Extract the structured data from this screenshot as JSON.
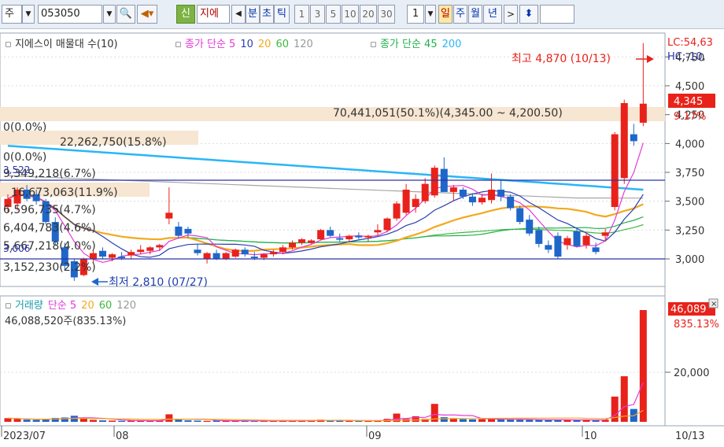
{
  "toolbar": {
    "market": "주",
    "code": "053050",
    "name": "지에",
    "badge": "신",
    "branch_label": "분",
    "chart_label": "초",
    "tick_label": "틱",
    "periods": [
      "1",
      "3",
      "5",
      "10",
      "20",
      "30"
    ],
    "interval_value": "1",
    "day": "일",
    "week": "주",
    "month": "월",
    "year": "년"
  },
  "price_panel": {
    "legend": {
      "title": "지에스이 매물대 수(10)",
      "ma_label_a": "종가 단순 5",
      "ma_a_rest": [
        "10",
        "20",
        "60",
        "120"
      ],
      "ma_label_b": "종가 단순 45",
      "ma_b_rest": "200"
    },
    "volume_profile": [
      "70,441,051(50.1%)(4,345.00 ~ 4,200.50)",
      "0(0.0%)",
      "22,262,750(15.8%)",
      "0(0.0%)",
      "9,349,218(6.7%)",
      "16,673,063(11.9%)",
      "6,596,735(4.7%)",
      "6,404,783(4.6%)",
      "5,667,218(4.0%)",
      "3,152,230(2.2%)"
    ],
    "left_labels": [
      "3,522",
      "3,006"
    ],
    "annotation_high": "최고 4,870 (10/13)",
    "annotation_low": "최저 2,810 (07/27)",
    "right_labels": {
      "lc": "LC:54,63",
      "hc": "HC:-10,",
      "last_price": "4,345",
      "change_pct": "9.17%"
    },
    "yaxis_ticks": [
      "4,750",
      "4,500",
      "4,250",
      "4,000",
      "3,750",
      "3,500",
      "3,250",
      "3,000"
    ]
  },
  "volume_panel": {
    "legend_title": "거래량",
    "legend_ma": "단순 5",
    "legend_ma_rest": [
      "20",
      "60",
      "120"
    ],
    "value_text": "46,088,520주(835.13%)",
    "right_value": "46,089",
    "right_pct": "835.13%",
    "yaxis_tick": "20,000"
  },
  "xaxis": {
    "labels": [
      "2023/07",
      "08",
      "09",
      "10"
    ],
    "end_label": "10/13"
  },
  "colors": {
    "up": "#e8221b",
    "down": "#1f66c9",
    "ma5": "#e33ad8",
    "ma10": "#2c3fb0",
    "ma20": "#f2a91d",
    "ma60": "#3fb83f",
    "ma120": "#a6a6a6",
    "ma45": "#22b14c",
    "ma200": "#29b6f6"
  },
  "candles": [
    {
      "o": 3450,
      "h": 3560,
      "l": 3400,
      "c": 3520
    },
    {
      "o": 3480,
      "h": 3620,
      "l": 3420,
      "c": 3600
    },
    {
      "o": 3600,
      "h": 3640,
      "l": 3500,
      "c": 3520
    },
    {
      "o": 3560,
      "h": 3600,
      "l": 3470,
      "c": 3500
    },
    {
      "o": 3500,
      "h": 3520,
      "l": 3300,
      "c": 3320
    },
    {
      "o": 3320,
      "h": 3360,
      "l": 3120,
      "c": 3150
    },
    {
      "o": 3100,
      "h": 3140,
      "l": 2900,
      "c": 2940
    },
    {
      "o": 2980,
      "h": 3000,
      "l": 2810,
      "c": 2840
    },
    {
      "o": 2860,
      "h": 3010,
      "l": 2850,
      "c": 3000
    },
    {
      "o": 3000,
      "h": 3080,
      "l": 2960,
      "c": 3050
    },
    {
      "o": 3070,
      "h": 3100,
      "l": 3000,
      "c": 3020
    },
    {
      "o": 3010,
      "h": 3050,
      "l": 2980,
      "c": 3040
    },
    {
      "o": 3020,
      "h": 3060,
      "l": 2990,
      "c": 3010
    },
    {
      "o": 3030,
      "h": 3080,
      "l": 3000,
      "c": 3060
    },
    {
      "o": 3060,
      "h": 3120,
      "l": 3040,
      "c": 3080
    },
    {
      "o": 3070,
      "h": 3110,
      "l": 3040,
      "c": 3100
    },
    {
      "o": 3100,
      "h": 3130,
      "l": 3070,
      "c": 3120
    },
    {
      "o": 3350,
      "h": 3620,
      "l": 3300,
      "c": 3400
    },
    {
      "o": 3280,
      "h": 3320,
      "l": 3180,
      "c": 3200
    },
    {
      "o": 3260,
      "h": 3280,
      "l": 3180,
      "c": 3220
    },
    {
      "o": 3080,
      "h": 3130,
      "l": 3030,
      "c": 3050
    },
    {
      "o": 3000,
      "h": 3060,
      "l": 2960,
      "c": 3050
    },
    {
      "o": 3050,
      "h": 3080,
      "l": 2990,
      "c": 3000
    },
    {
      "o": 3000,
      "h": 3060,
      "l": 2990,
      "c": 3050
    },
    {
      "o": 3020,
      "h": 3090,
      "l": 3010,
      "c": 3080
    },
    {
      "o": 3080,
      "h": 3100,
      "l": 3020,
      "c": 3040
    },
    {
      "o": 3020,
      "h": 3060,
      "l": 2990,
      "c": 3010
    },
    {
      "o": 3010,
      "h": 3050,
      "l": 2990,
      "c": 3040
    },
    {
      "o": 3040,
      "h": 3080,
      "l": 3020,
      "c": 3060
    },
    {
      "o": 3060,
      "h": 3120,
      "l": 3040,
      "c": 3100
    },
    {
      "o": 3100,
      "h": 3160,
      "l": 3080,
      "c": 3140
    },
    {
      "o": 3140,
      "h": 3180,
      "l": 3120,
      "c": 3170
    },
    {
      "o": 3140,
      "h": 3170,
      "l": 3130,
      "c": 3160
    },
    {
      "o": 3170,
      "h": 3260,
      "l": 3160,
      "c": 3250
    },
    {
      "o": 3250,
      "h": 3280,
      "l": 3190,
      "c": 3200
    },
    {
      "o": 3180,
      "h": 3220,
      "l": 3150,
      "c": 3170
    },
    {
      "o": 3170,
      "h": 3210,
      "l": 3150,
      "c": 3200
    },
    {
      "o": 3200,
      "h": 3230,
      "l": 3170,
      "c": 3190
    },
    {
      "o": 3190,
      "h": 3210,
      "l": 3150,
      "c": 3200
    },
    {
      "o": 3230,
      "h": 3300,
      "l": 3200,
      "c": 3250
    },
    {
      "o": 3250,
      "h": 3360,
      "l": 3230,
      "c": 3350
    },
    {
      "o": 3350,
      "h": 3500,
      "l": 3330,
      "c": 3480
    },
    {
      "o": 3400,
      "h": 3650,
      "l": 3380,
      "c": 3600
    },
    {
      "o": 3450,
      "h": 3560,
      "l": 3400,
      "c": 3520
    },
    {
      "o": 3500,
      "h": 3700,
      "l": 3480,
      "c": 3650
    },
    {
      "o": 3550,
      "h": 3810,
      "l": 3530,
      "c": 3790
    },
    {
      "o": 3780,
      "h": 3880,
      "l": 3600,
      "c": 3580
    },
    {
      "o": 3580,
      "h": 3640,
      "l": 3500,
      "c": 3620
    },
    {
      "o": 3600,
      "h": 3620,
      "l": 3520,
      "c": 3540
    },
    {
      "o": 3540,
      "h": 3570,
      "l": 3460,
      "c": 3490
    },
    {
      "o": 3490,
      "h": 3560,
      "l": 3470,
      "c": 3530
    },
    {
      "o": 3510,
      "h": 3740,
      "l": 3480,
      "c": 3600
    },
    {
      "o": 3600,
      "h": 3680,
      "l": 3500,
      "c": 3540
    },
    {
      "o": 3540,
      "h": 3560,
      "l": 3420,
      "c": 3440
    },
    {
      "o": 3440,
      "h": 3460,
      "l": 3300,
      "c": 3320
    },
    {
      "o": 3340,
      "h": 3380,
      "l": 3200,
      "c": 3220
    },
    {
      "o": 3250,
      "h": 3280,
      "l": 3100,
      "c": 3130
    },
    {
      "o": 3120,
      "h": 3160,
      "l": 3050,
      "c": 3080
    },
    {
      "o": 3200,
      "h": 3230,
      "l": 3000,
      "c": 3020
    },
    {
      "o": 3120,
      "h": 3200,
      "l": 3080,
      "c": 3180
    },
    {
      "o": 3240,
      "h": 3260,
      "l": 3100,
      "c": 3110
    },
    {
      "o": 3120,
      "h": 3230,
      "l": 3090,
      "c": 3200
    },
    {
      "o": 3100,
      "h": 3140,
      "l": 3040,
      "c": 3060
    },
    {
      "o": 3200,
      "h": 3260,
      "l": 3150,
      "c": 3230
    },
    {
      "o": 3450,
      "h": 4100,
      "l": 3420,
      "c": 4080
    },
    {
      "o": 3700,
      "h": 4380,
      "l": 3650,
      "c": 4350
    },
    {
      "o": 4080,
      "h": 4170,
      "l": 3980,
      "c": 4020
    },
    {
      "o": 4180,
      "h": 4870,
      "l": 4150,
      "c": 4345
    }
  ],
  "volumes": [
    1.5,
    1.2,
    0.9,
    0.8,
    1.2,
    1.6,
    1.8,
    2.5,
    1.4,
    0.8,
    0.6,
    0.5,
    0.4,
    0.6,
    0.5,
    0.4,
    0.5,
    3.1,
    0.9,
    0.6,
    0.5,
    0.4,
    0.5,
    0.4,
    0.4,
    0.4,
    0.3,
    0.4,
    0.4,
    0.5,
    0.4,
    0.6,
    0.4,
    0.9,
    0.6,
    0.5,
    0.4,
    0.4,
    0.5,
    0.6,
    1.2,
    3.4,
    1.2,
    2.3,
    1.2,
    7.4,
    1.9,
    1.5,
    1.1,
    1.0,
    1.1,
    1.2,
    1.0,
    0.9,
    0.8,
    1.0,
    0.8,
    0.7,
    0.9,
    0.8,
    0.7,
    0.8,
    0.6,
    0.8,
    10.4,
    18.8,
    5.3,
    46.1
  ]
}
